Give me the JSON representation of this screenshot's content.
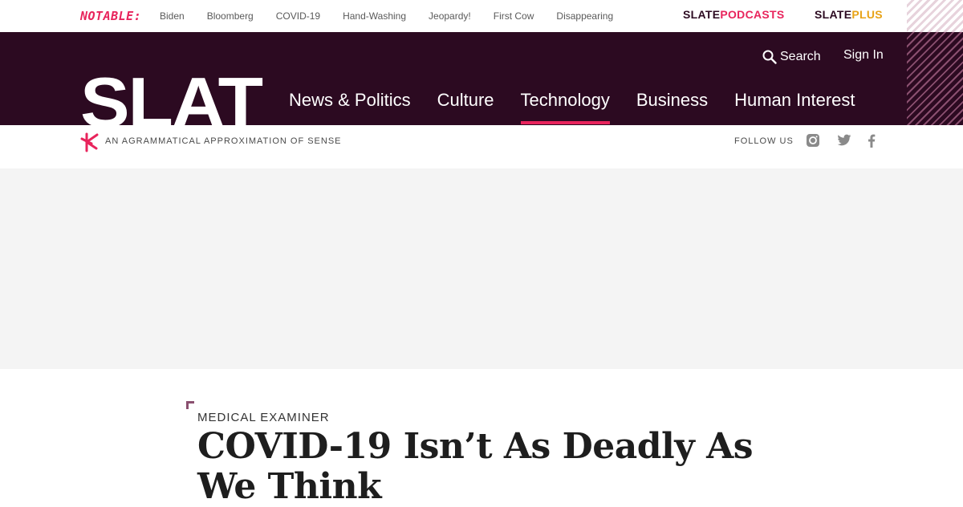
{
  "notable": {
    "label": "NOTABLE:",
    "links": [
      "Biden",
      "Bloomberg",
      "COVID-19",
      "Hand-Washing",
      "Jeopardy!",
      "First Cow",
      "Disappearing"
    ]
  },
  "brands": {
    "podcasts_a": "SLATE",
    "podcasts_b": "PODCASTS",
    "plus_a": "SLATE",
    "plus_b": "PLUS"
  },
  "header": {
    "search_label": "Search",
    "signin_label": "Sign In",
    "logo_text": "SLATE",
    "nav": [
      {
        "label": "News & Politics",
        "active": false
      },
      {
        "label": "Culture",
        "active": false
      },
      {
        "label": "Technology",
        "active": true
      },
      {
        "label": "Business",
        "active": false
      },
      {
        "label": "Human Interest",
        "active": false
      }
    ]
  },
  "tagline": {
    "text": "An agrammatical approximation of sense",
    "follow_label": "FOLLOW US"
  },
  "article": {
    "kicker": "Medical Examiner",
    "headline": "COVID-19 Isn’t As Deadly As We Think"
  },
  "colors": {
    "brand_purple": "#2c0a21",
    "accent_pink": "#e8245c",
    "plus_gold": "#e8a317"
  }
}
